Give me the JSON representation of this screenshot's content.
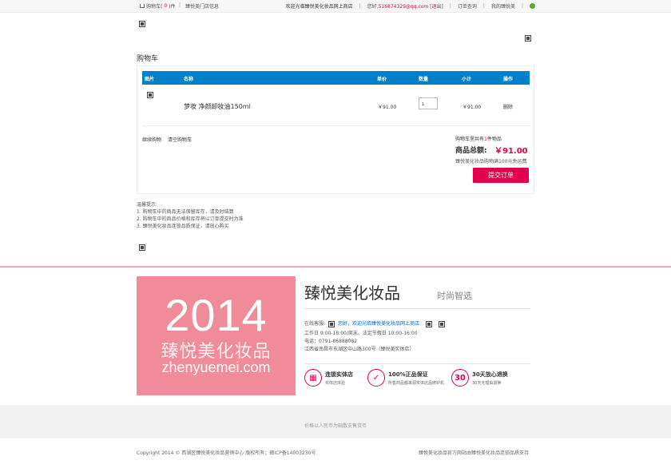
{
  "topbar": {
    "cart_label": "购物车(",
    "cart_count": "0",
    "cart_suffix": ")件",
    "store_info": "臻悦美门店信息",
    "welcome": "欢迎光临臻悦美化妆品网上商店",
    "hello": "您好,",
    "email": "516874329@qq.com",
    "logout": "退出",
    "order_query": "订单查询",
    "my_account": "我的臻悦美"
  },
  "cart": {
    "title": "购物车",
    "headers": {
      "image": "图片",
      "name": "名称",
      "price": "单价",
      "quantity": "数量",
      "subtotal": "小计",
      "action": "操作"
    },
    "items": [
      {
        "name": "梦妆 净颜卸妆油150ml",
        "price": "￥91.00",
        "quantity": "1",
        "subtotal": "￥91.00",
        "action": "删除"
      }
    ],
    "continue_shopping": "继续购物",
    "clear_cart": "清空购物车",
    "item_count_prefix": "购物车里共有",
    "item_count": "1",
    "item_count_suffix": "件物品",
    "total_label": "商品总额:",
    "total_value": "￥91.00",
    "shipping_note": "臻悦美化妆品购物满100元免运费",
    "submit_label": "提交订单"
  },
  "tips": {
    "title": "温馨提示:",
    "lines": [
      "1.    购物车中的商品无法保留库存，请及时结算",
      "2.    购物车中的商品价格和库存将以订单提交时为准",
      "3.    臻悦美化妆品连锁品质保证，请放心购买"
    ]
  },
  "footer": {
    "promo_year": "2014",
    "promo_cn": "臻悦美化妆品",
    "promo_domain": "zhenyuemei.com",
    "brand_name": "臻悦美化妆品",
    "brand_slogan": "时尚智选",
    "service_label": "在线客服:",
    "service_link": "您好，欢迎光临臻悦美化妆品网上商店",
    "hours": "工作日 9:00-18:00/周末、法定节假日 10:00-16:00",
    "phone": "电话：0791-86888082",
    "address": "江西省南昌市东湖区中山路300号（臻悦美实体店）",
    "features": [
      {
        "icon": "store-icon",
        "glyph": "▦",
        "title": "连锁实体店",
        "sub": "实体店体验"
      },
      {
        "icon": "shield-icon",
        "glyph": "✓",
        "title": "100%正品保证",
        "sub": "所售商品都来源实体店品牌护机"
      },
      {
        "icon": "thirty-icon",
        "glyph": "30",
        "title": "30天放心退换",
        "sub": "30天无理由退换"
      }
    ],
    "price_note": "价格以人民币为础散支售货币",
    "copyright": "Copyright 2014 © 西湖区臻悦美化妆品营销中心 版权所有；赣ICP备14003230号",
    "support": "臻悦美化妆品官方网站由臻悦美化妆品连锁品质支持"
  },
  "colors": {
    "accent": "#e4004f",
    "header_blue": "#0080c8",
    "promo_pink": "#f08b99"
  }
}
